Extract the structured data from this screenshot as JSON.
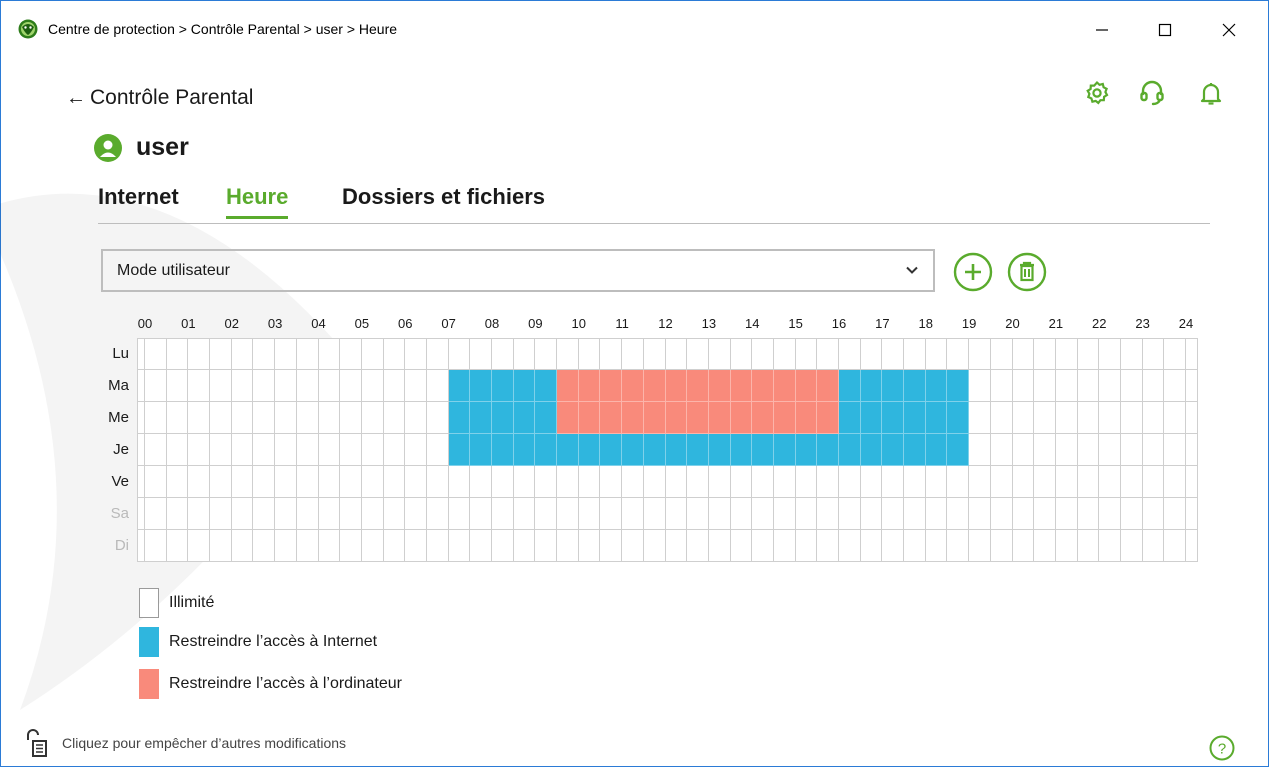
{
  "window": {
    "title": "Centre de protection > Contrôle Parental > user > Heure",
    "minimize_glyph": "—",
    "maximize_glyph": "☐",
    "close_glyph": "✕"
  },
  "header": {
    "back_label": "Contrôle Parental",
    "back_icon": "←",
    "icons": [
      "gear-icon",
      "headset-icon",
      "bell-icon"
    ]
  },
  "user": {
    "name": "user"
  },
  "tabs": [
    {
      "label": "Internet",
      "active": false
    },
    {
      "label": "Heure",
      "active": true
    },
    {
      "label": "Dossiers et fichiers",
      "active": false
    }
  ],
  "mode": {
    "selected": "Mode utilisateur"
  },
  "schedule": {
    "hours": [
      "00",
      "01",
      "02",
      "03",
      "04",
      "05",
      "06",
      "07",
      "08",
      "09",
      "10",
      "11",
      "12",
      "13",
      "14",
      "15",
      "16",
      "17",
      "18",
      "19",
      "20",
      "21",
      "22",
      "23",
      "24"
    ],
    "days": [
      {
        "label": "Lu",
        "weekend": false,
        "ranges": []
      },
      {
        "label": "Ma",
        "weekend": false,
        "ranges": [
          {
            "from": 7.0,
            "to": 9.5,
            "kind": "internet"
          },
          {
            "from": 9.5,
            "to": 16.0,
            "kind": "computer"
          },
          {
            "from": 16.0,
            "to": 19.0,
            "kind": "internet"
          }
        ]
      },
      {
        "label": "Me",
        "weekend": false,
        "ranges": [
          {
            "from": 7.0,
            "to": 9.5,
            "kind": "internet"
          },
          {
            "from": 9.5,
            "to": 16.0,
            "kind": "computer"
          },
          {
            "from": 16.0,
            "to": 19.0,
            "kind": "internet"
          }
        ]
      },
      {
        "label": "Je",
        "weekend": false,
        "ranges": [
          {
            "from": 7.0,
            "to": 19.0,
            "kind": "internet"
          }
        ]
      },
      {
        "label": "Ve",
        "weekend": false,
        "ranges": []
      },
      {
        "label": "Sa",
        "weekend": true,
        "ranges": []
      },
      {
        "label": "Di",
        "weekend": true,
        "ranges": []
      }
    ],
    "colors": {
      "internet": "#2fb6de",
      "computer": "#f98a7b",
      "unlimited": "#ffffff",
      "accent": "#5aab2d"
    }
  },
  "legend": [
    {
      "label": "Illimité",
      "kind": "unlimited"
    },
    {
      "label": "Restreindre l’accès à Internet",
      "kind": "internet"
    },
    {
      "label": "Restreindre l’accès à l’ordinateur",
      "kind": "computer"
    }
  ],
  "footer": {
    "lock_text": "Cliquez pour empêcher d’autres modifications",
    "help_icon": "?"
  }
}
